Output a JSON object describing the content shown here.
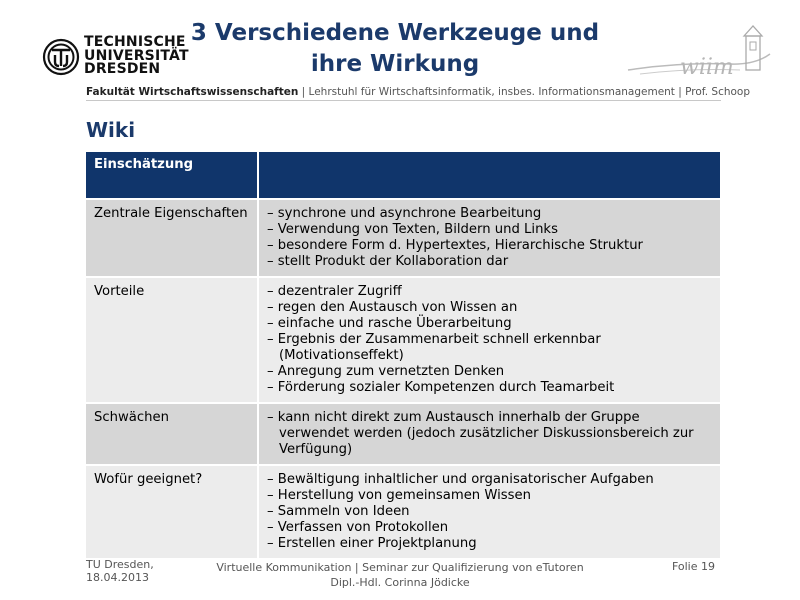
{
  "header": {
    "logo_lines": [
      "TECHNISCHE",
      "UNIVERSITÄT",
      "DRESDEN"
    ],
    "title_line1": "3 Verschiedene Werkzeuge und",
    "title_line2": "ihre Wirkung",
    "wiim_logo_text": "wiim",
    "faculty_bold": "Fakultät Wirtschaftswissenschaften",
    "faculty_rest": " | Lehrstuhl für Wirtschaftsinformatik, insbes. Informationsmanagement | Prof. Schoop"
  },
  "section_title": "Wiki",
  "table": {
    "header": "Einschätzung",
    "rows": [
      {
        "label": "Zentrale Eigenschaften",
        "items": [
          "synchrone und asynchrone Bearbeitung",
          "Verwendung von Texten, Bildern und Links",
          "besondere Form d. Hypertextes, Hierarchische Struktur",
          "stellt Produkt der Kollaboration dar"
        ]
      },
      {
        "label": "Vorteile",
        "items": [
          "dezentraler Zugriff",
          "regen den Austausch von Wissen an",
          "einfache und rasche Überarbeitung",
          "Ergebnis der Zusammenarbeit schnell erkennbar (Motivationseffekt)",
          "Anregung zum vernetzten Denken",
          "Förderung sozialer Kompetenzen durch Teamarbeit"
        ]
      },
      {
        "label": "Schwächen",
        "items": [
          "kann nicht direkt zum Austausch innerhalb der Gruppe verwendet werden (jedoch zusätzlicher Diskussionsbereich zur Verfügung)"
        ]
      },
      {
        "label": "Wofür geeignet?",
        "items": [
          "Bewältigung inhaltlicher und organisatorischer Aufgaben",
          "Herstellung von gemeinsamen Wissen",
          "Sammeln von Ideen",
          "Verfassen von Protokollen",
          "Erstellen einer Projektplanung"
        ]
      }
    ]
  },
  "footer": {
    "left_line1": "TU Dresden,",
    "left_line2": "18.04.2013",
    "center_line1": "Virtuelle Kommunikation | Seminar zur Qualifizierung von eTutoren",
    "center_line2": "Dipl.-Hdl. Corinna Jödicke",
    "right": "Folie 19"
  },
  "colors": {
    "title": "#1b3a6b",
    "table_header": "#10356b",
    "row_dark": "#d6d6d6",
    "row_light": "#ececec"
  }
}
